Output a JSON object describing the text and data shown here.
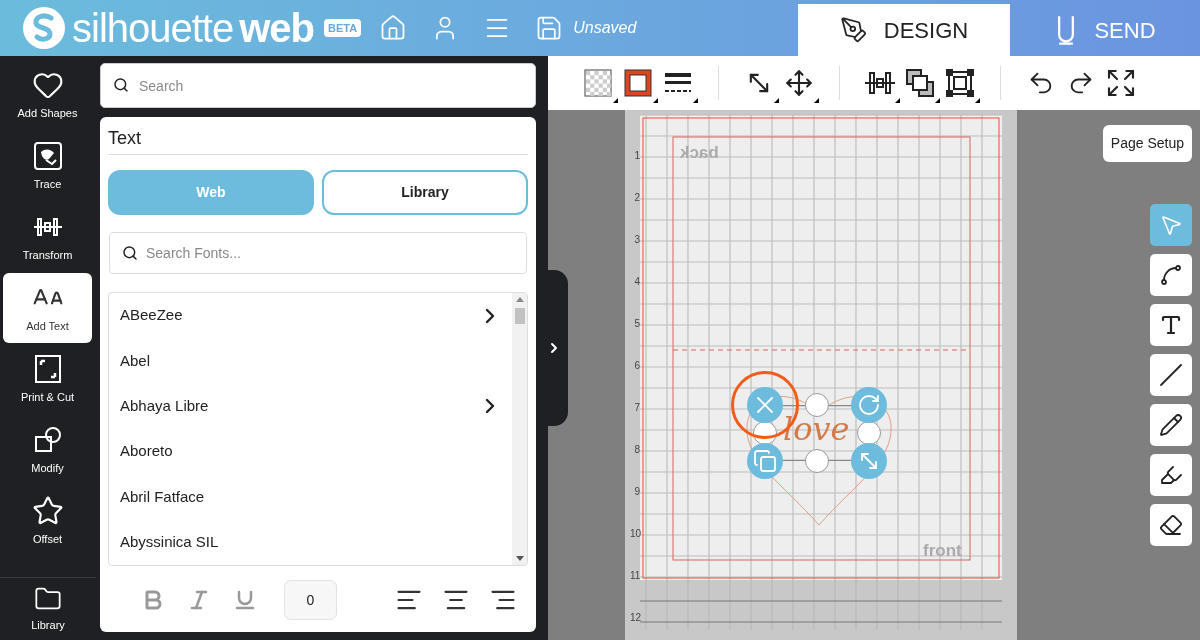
{
  "header": {
    "logo_light": "silhouette",
    "logo_bold": "web",
    "badge": "BETA",
    "file_status": "Unsaved",
    "tabs": [
      {
        "label": "DESIGN",
        "kind": "design",
        "selected": true
      },
      {
        "label": "SEND",
        "kind": "send",
        "selected": false
      }
    ]
  },
  "sidebar": {
    "items": [
      {
        "label": "Add Shapes",
        "kind": "shapes",
        "selected": false
      },
      {
        "label": "Trace",
        "kind": "trace",
        "selected": false
      },
      {
        "label": "Transform",
        "kind": "transform",
        "selected": false
      },
      {
        "label": "Add Text",
        "kind": "text",
        "selected": true
      },
      {
        "label": "Print & Cut",
        "kind": "printcut",
        "selected": false
      },
      {
        "label": "Modify",
        "kind": "modify",
        "selected": false
      },
      {
        "label": "Offset",
        "kind": "offset",
        "selected": false
      }
    ],
    "library": {
      "label": "Library"
    }
  },
  "panel": {
    "search": {
      "placeholder": "Search"
    },
    "title": "Text",
    "sources": [
      {
        "label": "Web",
        "selected": true
      },
      {
        "label": "Library",
        "selected": false
      }
    ],
    "font_search": {
      "placeholder": "Search Fonts..."
    },
    "fonts": [
      {
        "name": "ABeeZee",
        "expandable": true
      },
      {
        "name": "Abel",
        "expandable": false
      },
      {
        "name": "Abhaya Libre",
        "expandable": true
      },
      {
        "name": "Aboreto",
        "expandable": false
      },
      {
        "name": "Abril Fatface",
        "expandable": false
      },
      {
        "name": "Abyssinica SIL",
        "expandable": false
      }
    ],
    "spacing": "0"
  },
  "canvas": {
    "page_setup": "Page Setup",
    "ruler": [
      "1",
      "2",
      "3",
      "4",
      "5",
      "6",
      "7",
      "8",
      "9",
      "10",
      "11",
      "12"
    ],
    "back_label": "back",
    "front_label": "front",
    "design_text": "love",
    "tools": [
      {
        "kind": "select",
        "selected": true
      },
      {
        "kind": "point",
        "selected": false
      },
      {
        "kind": "text",
        "selected": false
      },
      {
        "kind": "line",
        "selected": false
      },
      {
        "kind": "pencil",
        "selected": false
      },
      {
        "kind": "marker",
        "selected": false
      },
      {
        "kind": "eraser",
        "selected": false
      }
    ]
  }
}
